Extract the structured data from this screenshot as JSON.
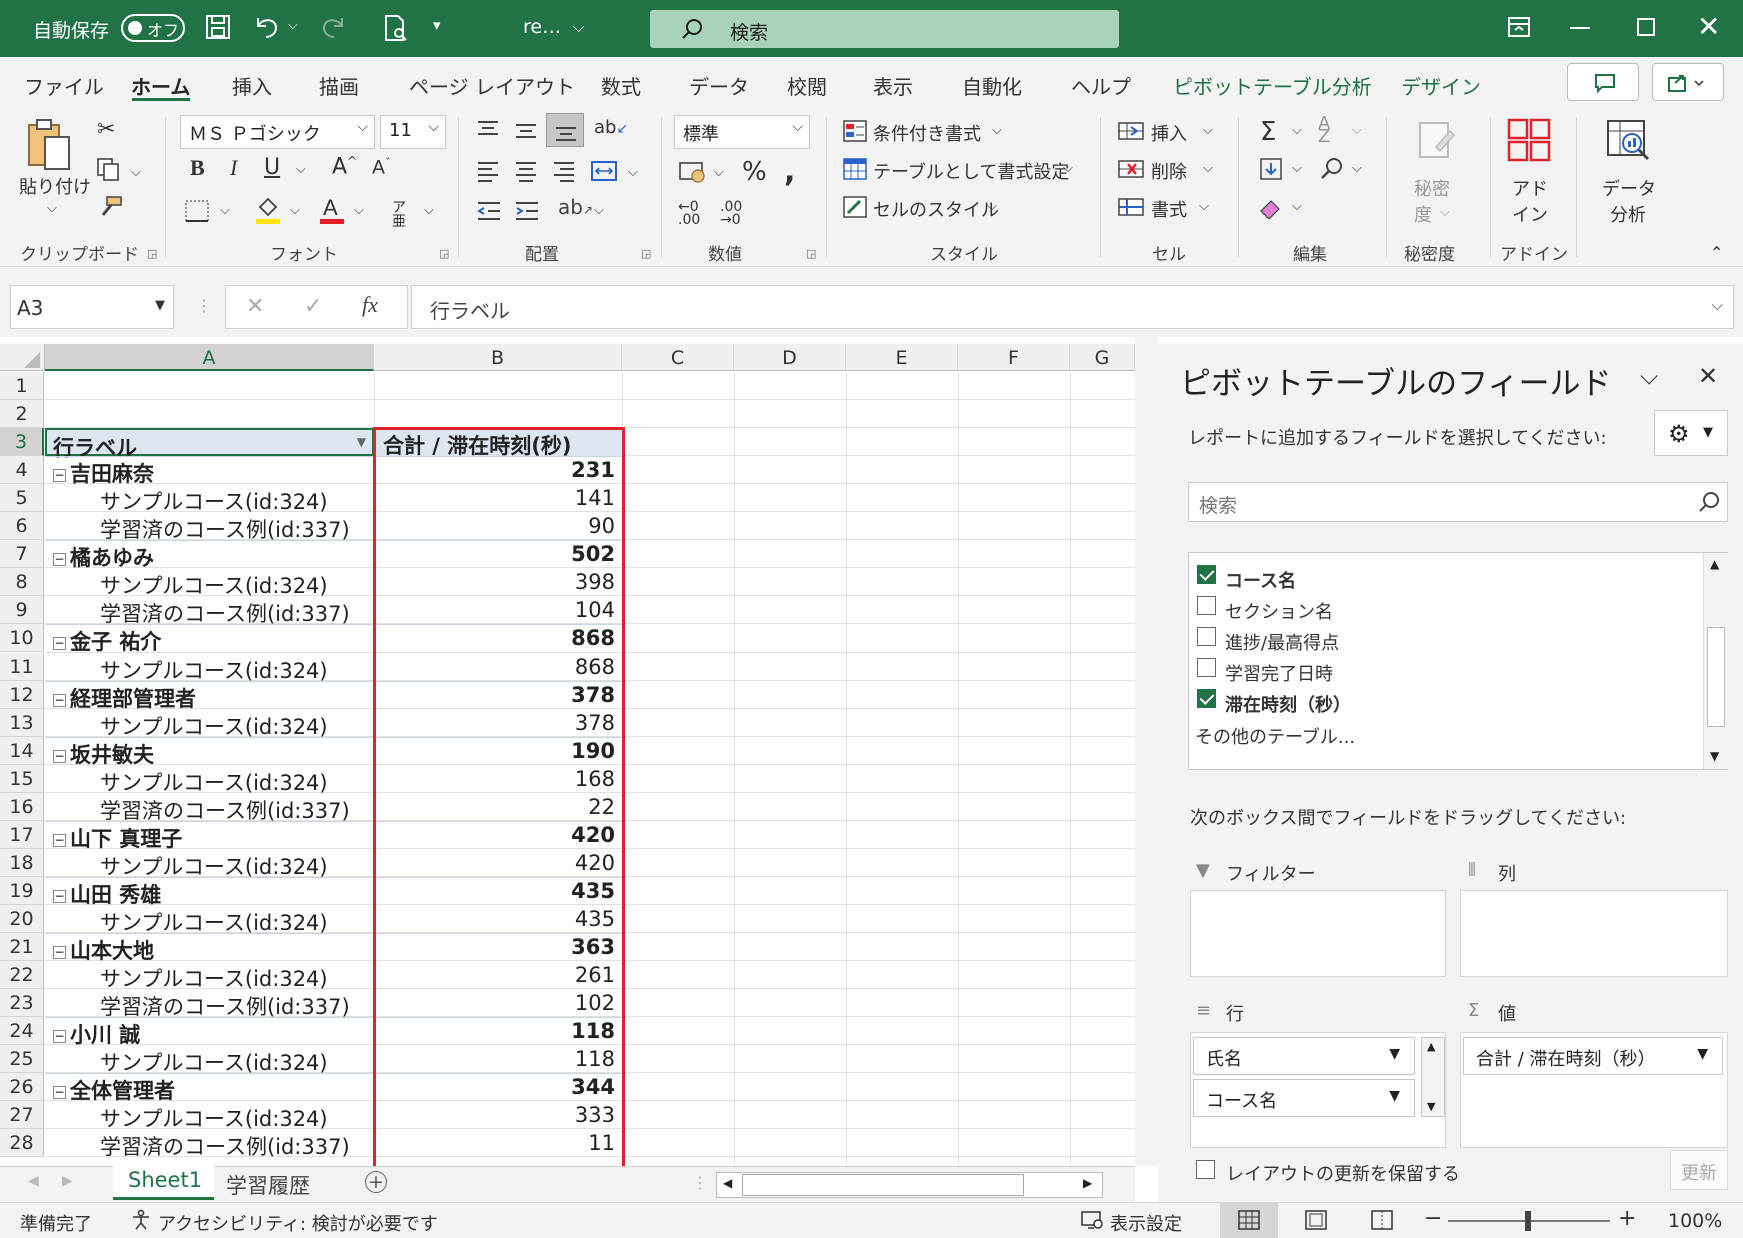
{
  "titlebar": {
    "autosave_label": "自動保存",
    "autosave_state": "オフ",
    "filename": "re…",
    "search_placeholder": "検索"
  },
  "tabs": [
    {
      "label": "ファイル"
    },
    {
      "label": "ホーム"
    },
    {
      "label": "挿入"
    },
    {
      "label": "描画"
    },
    {
      "label": "ページ レイアウト"
    },
    {
      "label": "数式"
    },
    {
      "label": "データ"
    },
    {
      "label": "校閲"
    },
    {
      "label": "表示"
    },
    {
      "label": "自動化"
    },
    {
      "label": "ヘルプ"
    },
    {
      "label": "ピボットテーブル分析"
    },
    {
      "label": "デザイン"
    }
  ],
  "ribbon": {
    "clipboard": {
      "paste": "貼り付け",
      "group": "クリップボード"
    },
    "font": {
      "name": "ＭＳ Ｐゴシック",
      "size": "11",
      "group": "フォント"
    },
    "alignment": {
      "group": "配置"
    },
    "number": {
      "format": "標準",
      "group": "数値"
    },
    "styles": {
      "conditional": "条件付き書式",
      "as_table": "テーブルとして書式設定",
      "cell_styles": "セルのスタイル",
      "group": "スタイル"
    },
    "cells": {
      "insert": "挿入",
      "delete": "削除",
      "format": "書式",
      "group": "セル"
    },
    "editing": {
      "group": "編集"
    },
    "sensitivity": {
      "label1": "秘密",
      "label2": "度",
      "group": "秘密度"
    },
    "addins": {
      "label1": "アド",
      "label2": "イン",
      "group": "アドイン"
    },
    "analyze": {
      "label1": "データ",
      "label2": "分析"
    }
  },
  "formula_bar": {
    "name_box": "A3",
    "fx": "fx",
    "formula": "行ラベル"
  },
  "grid": {
    "columns": [
      "A",
      "B",
      "C",
      "D",
      "E",
      "F",
      "G"
    ],
    "header_row_label": "行ラベル",
    "header_value_label": "合計 / 滞在時刻(秒)",
    "rows": [
      {
        "num": "1",
        "a": "",
        "b": "",
        "kind": "empty"
      },
      {
        "num": "2",
        "a": "",
        "b": "",
        "kind": "empty"
      },
      {
        "num": "3",
        "a": "",
        "b": "",
        "kind": "header"
      },
      {
        "num": "4",
        "a": "吉田麻奈",
        "b": "231",
        "kind": "group"
      },
      {
        "num": "5",
        "a": "サンプルコース(id:324)",
        "b": "141",
        "kind": "item"
      },
      {
        "num": "6",
        "a": "学習済のコース例(id:337)",
        "b": "90",
        "kind": "item"
      },
      {
        "num": "7",
        "a": "橘あゆみ",
        "b": "502",
        "kind": "group"
      },
      {
        "num": "8",
        "a": "サンプルコース(id:324)",
        "b": "398",
        "kind": "item"
      },
      {
        "num": "9",
        "a": "学習済のコース例(id:337)",
        "b": "104",
        "kind": "item"
      },
      {
        "num": "10",
        "a": "金子 祐介",
        "b": "868",
        "kind": "group"
      },
      {
        "num": "11",
        "a": "サンプルコース(id:324)",
        "b": "868",
        "kind": "item"
      },
      {
        "num": "12",
        "a": "経理部管理者",
        "b": "378",
        "kind": "group"
      },
      {
        "num": "13",
        "a": "サンプルコース(id:324)",
        "b": "378",
        "kind": "item"
      },
      {
        "num": "14",
        "a": "坂井敏夫",
        "b": "190",
        "kind": "group"
      },
      {
        "num": "15",
        "a": "サンプルコース(id:324)",
        "b": "168",
        "kind": "item"
      },
      {
        "num": "16",
        "a": "学習済のコース例(id:337)",
        "b": "22",
        "kind": "item"
      },
      {
        "num": "17",
        "a": "山下 真理子",
        "b": "420",
        "kind": "group"
      },
      {
        "num": "18",
        "a": "サンプルコース(id:324)",
        "b": "420",
        "kind": "item"
      },
      {
        "num": "19",
        "a": "山田 秀雄",
        "b": "435",
        "kind": "group"
      },
      {
        "num": "20",
        "a": "サンプルコース(id:324)",
        "b": "435",
        "kind": "item"
      },
      {
        "num": "21",
        "a": "山本大地",
        "b": "363",
        "kind": "group"
      },
      {
        "num": "22",
        "a": "サンプルコース(id:324)",
        "b": "261",
        "kind": "item"
      },
      {
        "num": "23",
        "a": "学習済のコース例(id:337)",
        "b": "102",
        "kind": "item"
      },
      {
        "num": "24",
        "a": "小川 誠",
        "b": "118",
        "kind": "group"
      },
      {
        "num": "25",
        "a": "サンプルコース(id:324)",
        "b": "118",
        "kind": "item"
      },
      {
        "num": "26",
        "a": "全体管理者",
        "b": "344",
        "kind": "group"
      },
      {
        "num": "27",
        "a": "サンプルコース(id:324)",
        "b": "333",
        "kind": "item"
      },
      {
        "num": "28",
        "a": "学習済のコース例(id:337)",
        "b": "11",
        "kind": "item"
      }
    ]
  },
  "sheets": [
    {
      "label": "Sheet1",
      "active": true
    },
    {
      "label": "学習履歴",
      "active": false
    }
  ],
  "pane": {
    "title": "ピボットテーブルのフィールド",
    "subtitle": "レポートに追加するフィールドを選択してください:",
    "search_placeholder": "検索",
    "fields": [
      {
        "label": "コース名",
        "checked": true
      },
      {
        "label": "セクション名",
        "checked": false
      },
      {
        "label": "進捗/最高得点",
        "checked": false
      },
      {
        "label": "学習完了日時",
        "checked": false
      },
      {
        "label": "滞在時刻（秒）",
        "checked": true
      }
    ],
    "more_tables": "その他のテーブル...",
    "drag_hint": "次のボックス間でフィールドをドラッグしてください:",
    "filter_label": "フィルター",
    "columns_label": "列",
    "rows_label": "行",
    "values_label": "値",
    "row_fields": [
      "氏名",
      "コース名"
    ],
    "value_fields": [
      "合計 / 滞在時刻（秒）"
    ],
    "defer_label": "レイアウトの更新を保留する",
    "update_button": "更新"
  },
  "status": {
    "ready": "準備完了",
    "accessibility": "アクセシビリティ: 検討が必要です",
    "display_settings": "表示設定",
    "zoom": "100%"
  },
  "colors": {
    "excel_green": "#217346",
    "highlight_red": "#e3212b",
    "pivot_header": "#dce6f1"
  }
}
